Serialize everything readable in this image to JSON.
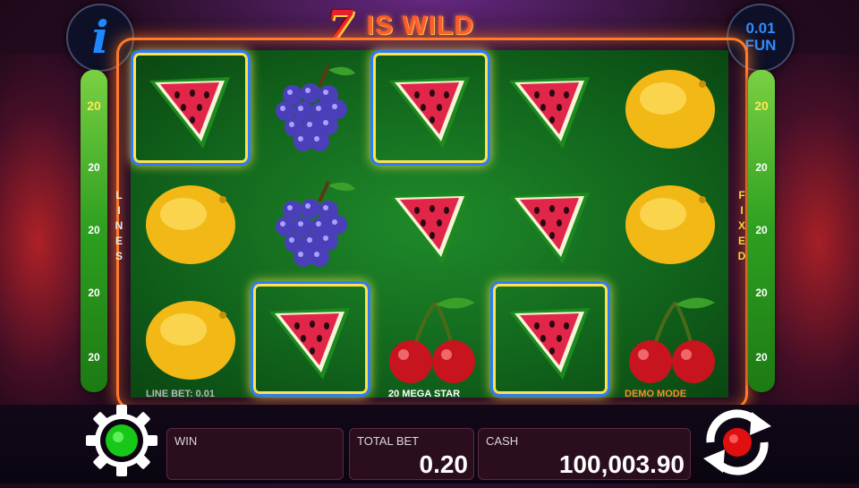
{
  "title": {
    "seven": "7",
    "text": "IS WILD"
  },
  "info_button": {
    "glyph": "i",
    "icon": "info-icon"
  },
  "denomination": {
    "value": "0.01",
    "label": "FUN"
  },
  "left_bar": {
    "numbers": [
      "20",
      "20",
      "20",
      "20",
      "20"
    ],
    "label": "LINES"
  },
  "right_bar": {
    "numbers": [
      "20",
      "20",
      "20",
      "20",
      "20"
    ],
    "label": "FIXED"
  },
  "reels": {
    "rows": [
      [
        "watermelon",
        "grapes",
        "watermelon",
        "watermelon",
        "lemon"
      ],
      [
        "lemon",
        "grapes",
        "watermelon",
        "watermelon",
        "lemon"
      ],
      [
        "lemon",
        "watermelon",
        "cherries",
        "watermelon",
        "cherries"
      ]
    ],
    "winning": [
      [
        0,
        0
      ],
      [
        0,
        2
      ],
      [
        2,
        1
      ],
      [
        2,
        3
      ]
    ]
  },
  "footer_labels": {
    "line_bet": "LINE BET: 0.01",
    "game_name": "20 MEGA STAR",
    "mode": "DEMO MODE"
  },
  "bottom": {
    "win_label": "WIN",
    "win_value": "",
    "total_bet_label": "TOTAL BET",
    "total_bet_value": "0.20",
    "cash_label": "CASH",
    "cash_value": "100,003.90"
  },
  "colors": {
    "accent": "#ff7a2a",
    "reel_bg": "#1f8a2a",
    "win_border": "#2b7dff",
    "fun_text": "#2f8cff"
  }
}
